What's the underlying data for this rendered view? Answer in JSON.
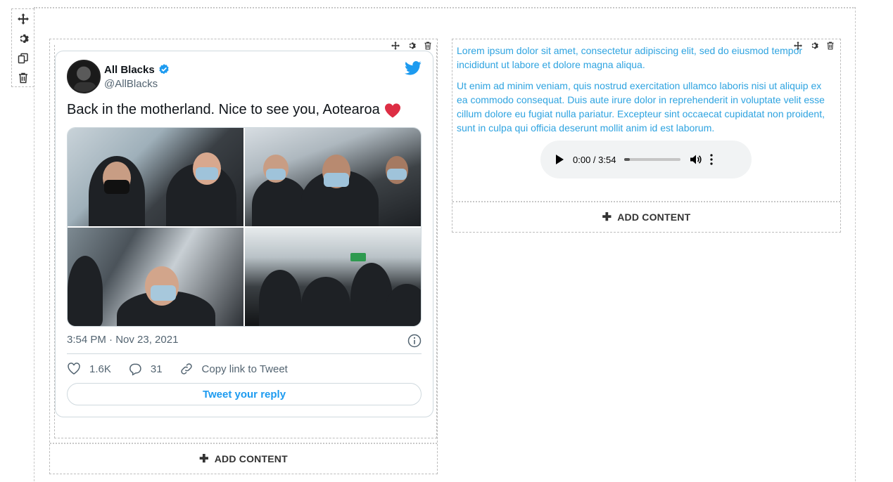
{
  "section_toolbar": {
    "icons": [
      "move-icon",
      "gear-icon",
      "duplicate-icon",
      "trash-icon"
    ]
  },
  "tweet": {
    "name": "All Blacks",
    "handle": "@AllBlacks",
    "text": "Back in the motherland. Nice to see you, Aotearoa",
    "timestamp": "3:54 PM · Nov 23, 2021",
    "likes": "1.6K",
    "replies": "31",
    "copy_link_label": "Copy link to Tweet",
    "reply_button_label": "Tweet your reply",
    "accent_color": "#1d9bf0",
    "heart_color": "#e0245e"
  },
  "text_module": {
    "paragraph1": "Lorem ipsum dolor sit amet, consectetur adipiscing elit, sed do eiusmod tempor incididunt ut labore et dolore magna aliqua.",
    "paragraph2": "Ut enim ad minim veniam, quis nostrud exercitation ullamco laboris nisi ut aliquip ex ea commodo consequat. Duis aute irure dolor in reprehenderit in voluptate velit esse cillum dolore eu fugiat nulla pariatur. Excepteur sint occaecat cupidatat non proident, sunt in culpa qui officia deserunt mollit anim id est laborum.",
    "text_color": "#2ea3e0"
  },
  "audio": {
    "time_display": "0:00 / 3:54"
  },
  "add_content_label": "ADD CONTENT"
}
